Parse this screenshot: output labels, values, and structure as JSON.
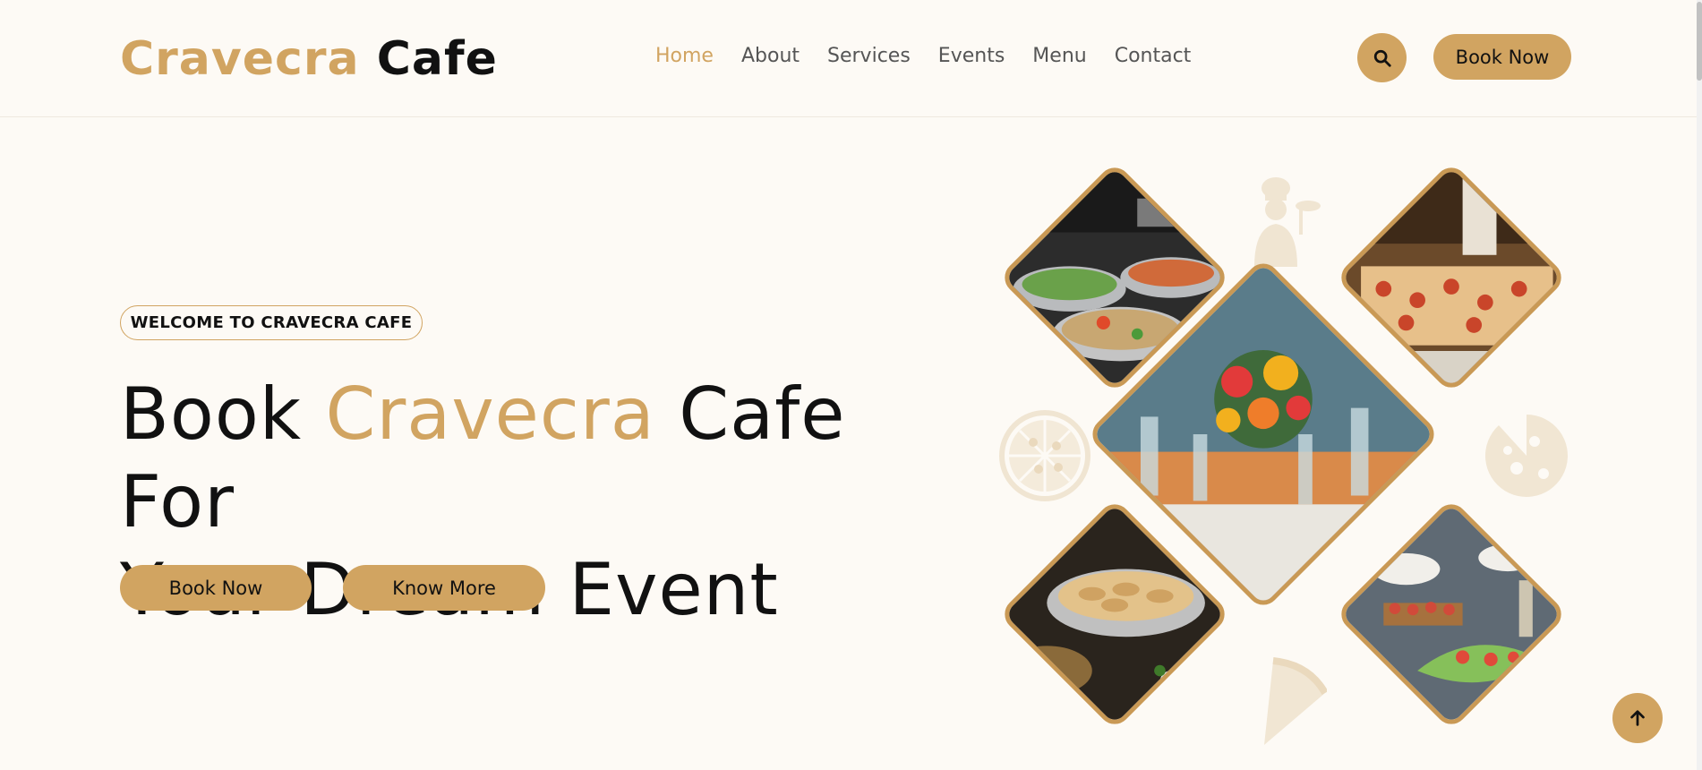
{
  "brand": {
    "part1": "Cravecra",
    "part2": "Cafe",
    "accent_color": "#d1a461"
  },
  "nav": {
    "links": [
      "Home",
      "About",
      "Services",
      "Events",
      "Menu",
      "Contact"
    ],
    "active": "Home",
    "search_icon": "search-icon",
    "book_label": "Book Now"
  },
  "hero": {
    "badge": "WELCOME TO CRAVECRA CAFE",
    "headline": {
      "pre": "Book",
      "accent": "Cravecra",
      "post": "Cafe For",
      "line2": "Your Dream Event"
    },
    "book_label": "Book Now",
    "more_label": "Know More"
  },
  "collage": {
    "images": [
      "salad-buffet-photo",
      "pizza-trays-photo",
      "table-flowers-photo",
      "pastry-buffet-photo",
      "appetizer-platter-photo"
    ],
    "decorations": [
      "chef-icon",
      "pizza-icon",
      "pizza-slice-icon"
    ]
  },
  "scroll_top_icon": "arrow-up-icon"
}
